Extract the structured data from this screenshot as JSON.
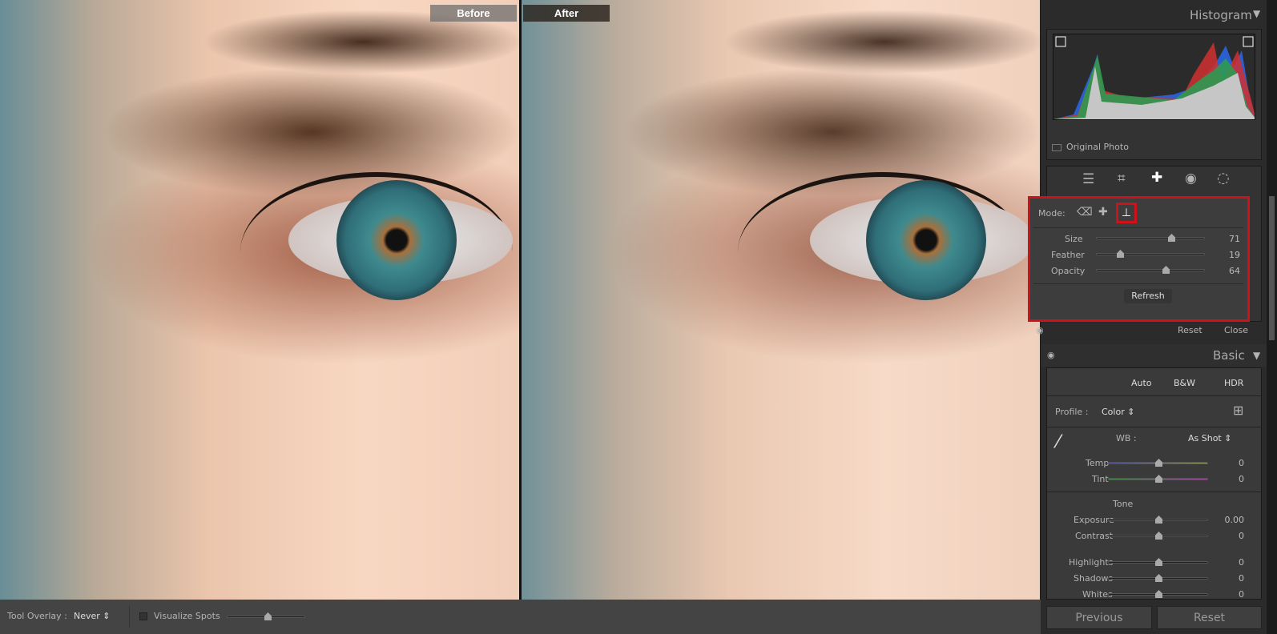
{
  "compare": {
    "before_label": "Before",
    "after_label": "After"
  },
  "histogram": {
    "title": "Histogram",
    "original_photo_label": "Original Photo"
  },
  "tools": {
    "icons": [
      "sliders-icon",
      "crop-icon",
      "healing-icon",
      "redeye-icon",
      "mask-icon"
    ],
    "active": "healing-icon"
  },
  "healing": {
    "mode_label": "Mode:",
    "modes": [
      "content-aware-remove-icon",
      "heal-icon",
      "clone-icon"
    ],
    "active_mode": "clone-icon",
    "sliders": [
      {
        "label": "Size",
        "value": "71",
        "level": 0.71
      },
      {
        "label": "Feather",
        "value": "19",
        "level": 0.19
      },
      {
        "label": "Opacity",
        "value": "64",
        "level": 0.64
      }
    ],
    "refresh_label": "Refresh",
    "reset_label": "Reset",
    "close_label": "Close",
    "highlight_color": "#d0101a"
  },
  "basic": {
    "title": "Basic",
    "auto": "Auto",
    "bw": "B&W",
    "hdr": "HDR",
    "profile_label": "Profile :",
    "profile_value": "Color",
    "wb_label": "WB :",
    "wb_value": "As Shot",
    "temp": {
      "label": "Temp",
      "value": "0"
    },
    "tint": {
      "label": "Tint",
      "value": "0"
    },
    "tone_label": "Tone",
    "tone": [
      {
        "label": "Exposure",
        "value": "0.00"
      },
      {
        "label": "Contrast",
        "value": "0"
      },
      {
        "label": "Highlights",
        "value": "0"
      },
      {
        "label": "Shadows",
        "value": "0"
      },
      {
        "label": "Whites",
        "value": "0"
      }
    ]
  },
  "footer": {
    "previous": "Previous",
    "reset": "Reset"
  },
  "toolbar": {
    "tool_overlay_label": "Tool Overlay :",
    "tool_overlay_value": "Never",
    "visualize_spots_label": "Visualize Spots",
    "visualize_spots_checked": false
  }
}
